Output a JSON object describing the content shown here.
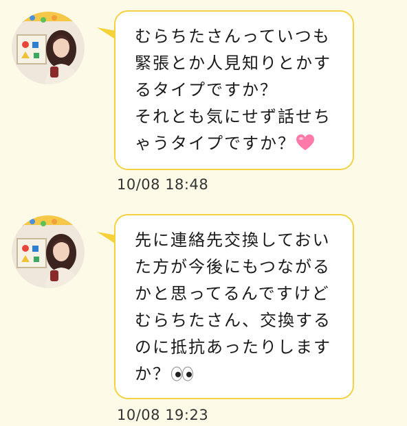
{
  "messages": [
    {
      "text": "むらちたさんっていつも\n緊張とか人見知りとかす\nるタイプですか？\nそれとも気にせず話せち\nゃうタイプですか？",
      "trailing_icon": "pink-heart-icon",
      "timestamp": "10/08 18:48"
    },
    {
      "text": "先に連絡先交換しておい\nた方が今後にもつながる\nかと思ってるんですけど\nむらちたさん、交換する\nのに抵抗あったりします\nか？",
      "trailing_icon": "eyes-icon",
      "timestamp": "10/08 19:23"
    }
  ],
  "colors": {
    "background": "#fdfbe8",
    "bubble_border": "#f3d142",
    "tail": "#f5d23a",
    "heart": "#ff7aa8"
  }
}
